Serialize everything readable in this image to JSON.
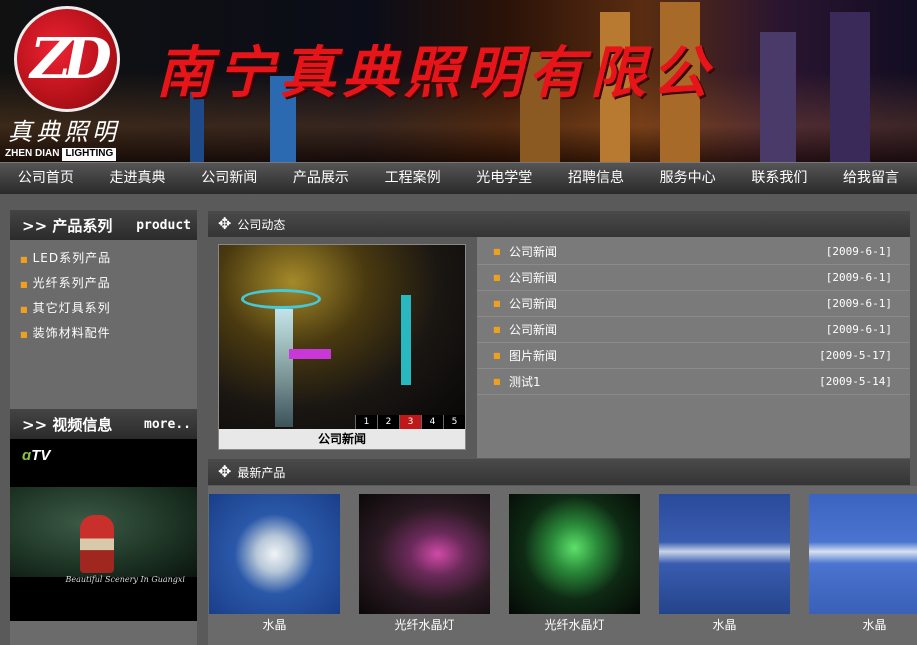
{
  "banner": {
    "logo_monogram": "ZD",
    "logo_cn": "真典照明",
    "logo_en_a": "ZHEN DIAN",
    "logo_en_b": "LIGHTING",
    "company_title": "南宁真典照明有限公"
  },
  "nav": [
    "公司首页",
    "走进真典",
    "公司新闻",
    "产品展示",
    "工程案例",
    "光电学堂",
    "招聘信息",
    "服务中心",
    "联系我们",
    "给我留言"
  ],
  "sidebar": {
    "products_title": ">> 产品系列",
    "products_more": "product",
    "product_items": [
      "LED系列产品",
      "光纤系列产品",
      "其它灯具系列",
      "装饰材料配件"
    ],
    "video_title": ">> 视频信息",
    "video_more": "more..",
    "video_logo": "TV",
    "video_caption": "Beautiful Scenery In Guangxi"
  },
  "news_section": {
    "title": "公司动态",
    "slide_caption": "公司新闻",
    "slide_numbers": [
      "1",
      "2",
      "3",
      "4",
      "5"
    ],
    "active_slide": "3",
    "items": [
      {
        "title": "公司新闻",
        "date": "[2009-6-1]"
      },
      {
        "title": "公司新闻",
        "date": "[2009-6-1]"
      },
      {
        "title": "公司新闻",
        "date": "[2009-6-1]"
      },
      {
        "title": "公司新闻",
        "date": "[2009-6-1]"
      },
      {
        "title": "图片新闻",
        "date": "[2009-5-17]"
      },
      {
        "title": "测试1",
        "date": "[2009-5-14]"
      }
    ]
  },
  "products_section": {
    "title": "最新产品",
    "items": [
      {
        "name": "水晶"
      },
      {
        "name": "光纤水晶灯"
      },
      {
        "name": "光纤水晶灯"
      },
      {
        "name": "水晶"
      },
      {
        "name": "水晶"
      }
    ]
  },
  "colors": {
    "title_red": "#e6151a",
    "bullet_orange": "#f0a020",
    "active_slide": "#c01818"
  }
}
